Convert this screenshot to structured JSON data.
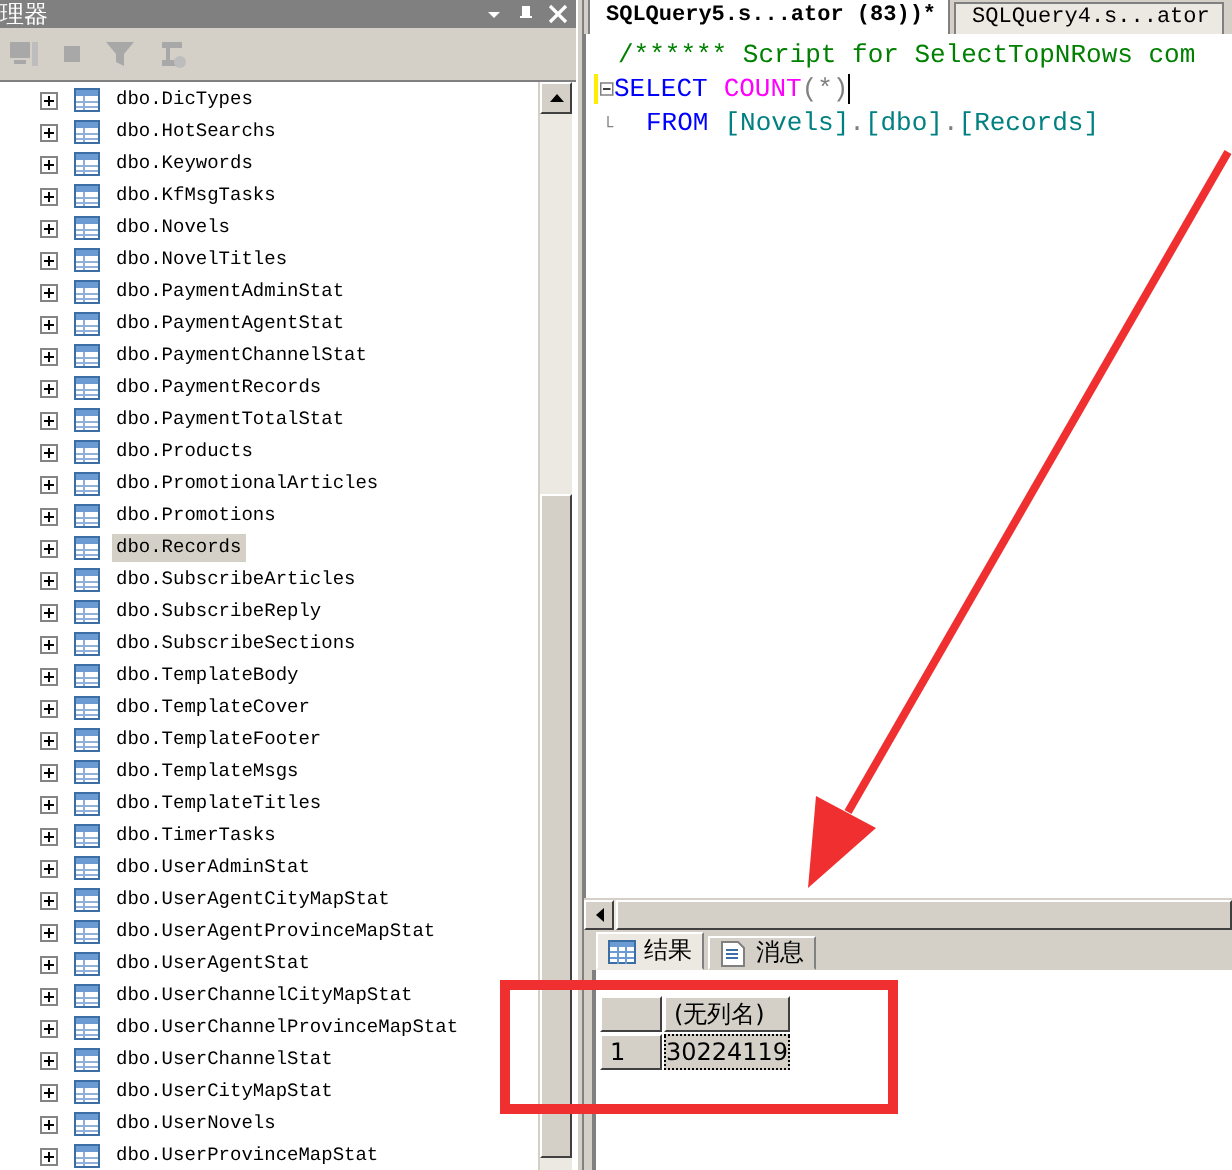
{
  "explorer": {
    "title": "理器",
    "items": [
      {
        "label": "dbo.DicTypes",
        "selected": false
      },
      {
        "label": "dbo.HotSearchs",
        "selected": false
      },
      {
        "label": "dbo.Keywords",
        "selected": false
      },
      {
        "label": "dbo.KfMsgTasks",
        "selected": false
      },
      {
        "label": "dbo.Novels",
        "selected": false
      },
      {
        "label": "dbo.NovelTitles",
        "selected": false
      },
      {
        "label": "dbo.PaymentAdminStat",
        "selected": false
      },
      {
        "label": "dbo.PaymentAgentStat",
        "selected": false
      },
      {
        "label": "dbo.PaymentChannelStat",
        "selected": false
      },
      {
        "label": "dbo.PaymentRecords",
        "selected": false
      },
      {
        "label": "dbo.PaymentTotalStat",
        "selected": false
      },
      {
        "label": "dbo.Products",
        "selected": false
      },
      {
        "label": "dbo.PromotionalArticles",
        "selected": false
      },
      {
        "label": "dbo.Promotions",
        "selected": false
      },
      {
        "label": "dbo.Records",
        "selected": true
      },
      {
        "label": "dbo.SubscribeArticles",
        "selected": false
      },
      {
        "label": "dbo.SubscribeReply",
        "selected": false
      },
      {
        "label": "dbo.SubscribeSections",
        "selected": false
      },
      {
        "label": "dbo.TemplateBody",
        "selected": false
      },
      {
        "label": "dbo.TemplateCover",
        "selected": false
      },
      {
        "label": "dbo.TemplateFooter",
        "selected": false
      },
      {
        "label": "dbo.TemplateMsgs",
        "selected": false
      },
      {
        "label": "dbo.TemplateTitles",
        "selected": false
      },
      {
        "label": "dbo.TimerTasks",
        "selected": false
      },
      {
        "label": "dbo.UserAdminStat",
        "selected": false
      },
      {
        "label": "dbo.UserAgentCityMapStat",
        "selected": false
      },
      {
        "label": "dbo.UserAgentProvinceMapStat",
        "selected": false
      },
      {
        "label": "dbo.UserAgentStat",
        "selected": false
      },
      {
        "label": "dbo.UserChannelCityMapStat",
        "selected": false
      },
      {
        "label": "dbo.UserChannelProvinceMapStat",
        "selected": false
      },
      {
        "label": "dbo.UserChannelStat",
        "selected": false
      },
      {
        "label": "dbo.UserCityMapStat",
        "selected": false
      },
      {
        "label": "dbo.UserNovels",
        "selected": false
      },
      {
        "label": "dbo.UserProvinceMapStat",
        "selected": false
      }
    ]
  },
  "editor": {
    "tabs": [
      {
        "label": "SQLQuery5.s...ator (83))*",
        "selected": true
      },
      {
        "label": "SQLQuery4.s...ator",
        "selected": false
      }
    ],
    "lines": [
      {
        "kind": "comment",
        "tokens": [
          {
            "kind": "comment",
            "text": "/****** Script for SelectTopNRows com"
          }
        ]
      },
      {
        "kind": "block-start",
        "tokens": [
          {
            "kind": "keyword",
            "text": "SELECT"
          },
          {
            "kind": "function",
            "text": "COUNT"
          },
          {
            "kind": "operator",
            "text": "(*)"
          }
        ]
      },
      {
        "kind": "block-end",
        "tokens": [
          {
            "kind": "keyword",
            "text": "FROM"
          },
          {
            "kind": "identifier",
            "text": "[Novels]"
          },
          {
            "kind": "operator",
            "text": "."
          },
          {
            "kind": "identifier",
            "text": "[dbo]"
          },
          {
            "kind": "operator",
            "text": "."
          },
          {
            "kind": "identifier",
            "text": "[Records]"
          }
        ]
      }
    ]
  },
  "results": {
    "tabs": [
      {
        "label": "结果",
        "kind": "grid",
        "selected": true
      },
      {
        "label": "消息",
        "kind": "messages",
        "selected": false
      }
    ],
    "columns": [
      "(无列名)"
    ],
    "rows": [
      {
        "number": "1",
        "cells": [
          "30224119"
        ]
      }
    ]
  }
}
